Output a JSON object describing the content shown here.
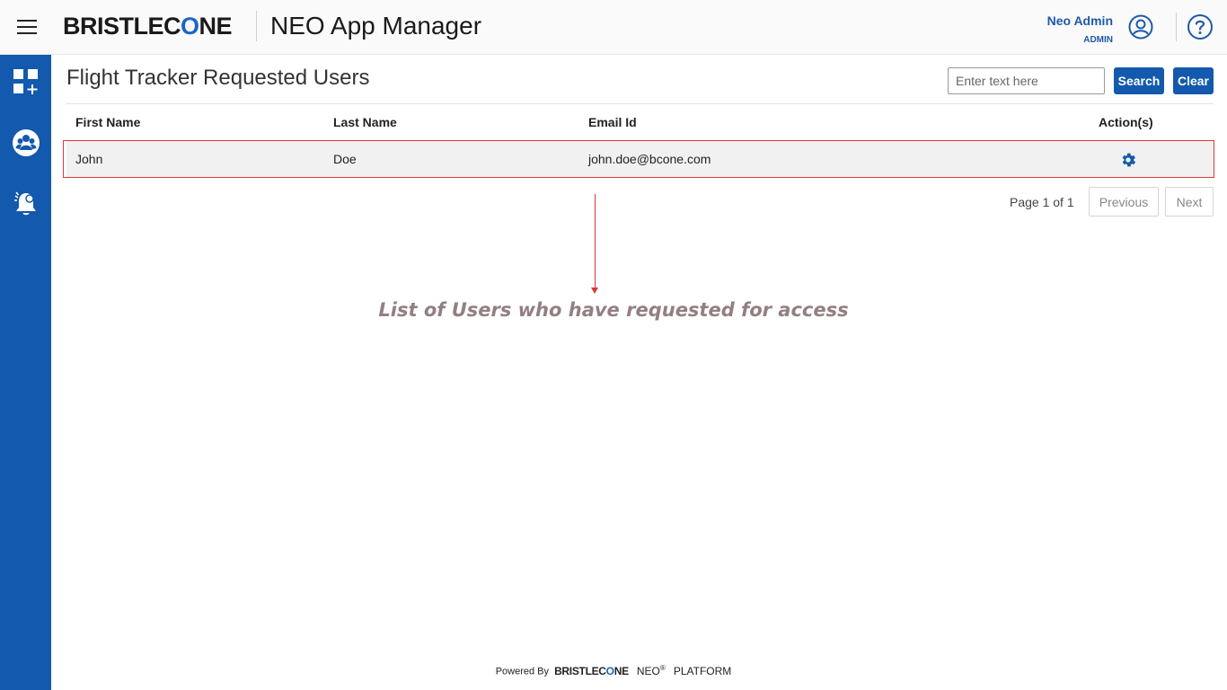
{
  "header": {
    "logo_text_before": "BRISTLEC",
    "logo_text_o": "O",
    "logo_text_after": "NE",
    "app_title": "NEO App Manager",
    "user_name": "Neo Admin",
    "user_role": "ADMIN",
    "icons": [
      "hamburger-menu-icon",
      "user-profile-icon",
      "help-icon"
    ]
  },
  "sidebar": {
    "items": [
      {
        "icon": "apps-add-icon"
      },
      {
        "icon": "user-group-icon"
      },
      {
        "icon": "notification-bell-icon"
      }
    ]
  },
  "main": {
    "title": "Flight Tracker Requested Users",
    "search": {
      "placeholder": "Enter text here",
      "value": "",
      "search_label": "Search",
      "clear_label": "Clear"
    },
    "table": {
      "columns": [
        "First Name",
        "Last Name",
        "Email Id",
        "Action(s)"
      ],
      "rows": [
        {
          "first_name": "John",
          "last_name": "Doe",
          "email": "john.doe@bcone.com",
          "action_icon": "settings-gear-icon"
        }
      ]
    },
    "pagination": {
      "page_text": "Page 1 of 1",
      "previous_label": "Previous",
      "next_label": "Next"
    },
    "annotation": "List of Users who have requested for access"
  },
  "footer": {
    "powered_by": "Powered By",
    "brand_before": "BRISTLEC",
    "brand_o": "O",
    "brand_after": "NE",
    "neo": "NEO",
    "registered": "®",
    "platform": "PLATFORM"
  },
  "colors": {
    "primary": "#1359ad",
    "accent_red": "#e03a3a",
    "annotation": "#937f82"
  }
}
